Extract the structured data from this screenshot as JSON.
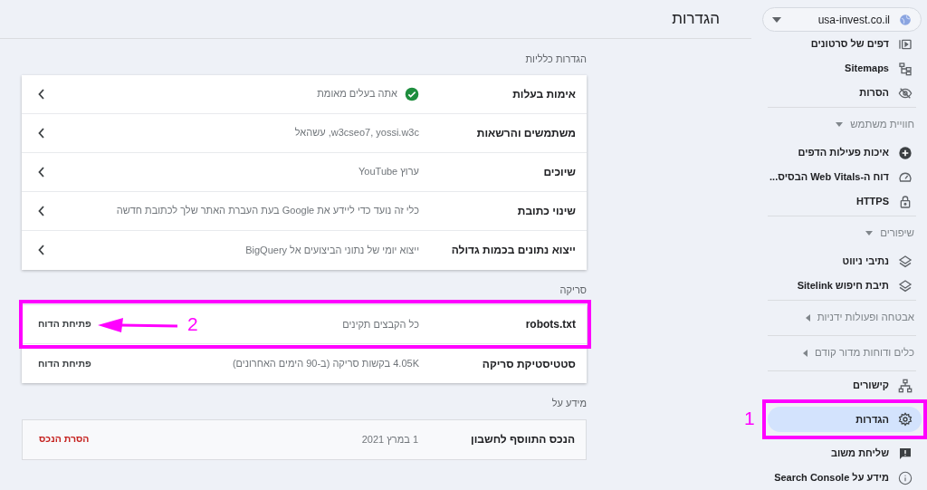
{
  "property_selector": {
    "value": "usa-invest.co.il"
  },
  "sidebar": {
    "sections": [
      {
        "items": [
          {
            "label": "דפים של סרטונים",
            "selected": false
          },
          {
            "label": "Sitemaps",
            "selected": false
          },
          {
            "label": "הסרות",
            "selected": false
          }
        ]
      },
      {
        "header": {
          "label": "חוויית משתמש",
          "expanded": true
        },
        "items": [
          {
            "label": "איכות פעילות הדפים",
            "selected": false
          },
          {
            "label": "דוח ה-Web Vitals הבסיס...",
            "selected": false
          },
          {
            "label": "HTTPS",
            "selected": false
          }
        ]
      },
      {
        "header": {
          "label": "שיפורים",
          "expanded": true
        },
        "items": [
          {
            "label": "נתיבי ניווט",
            "selected": false
          },
          {
            "label": "תיבת חיפוש Sitelink",
            "selected": false
          }
        ]
      },
      {
        "header": {
          "label": "אבטחה ופעולות ידניות",
          "expanded": false
        }
      },
      {
        "header": {
          "label": "כלים ודוחות מדור קודם",
          "expanded": false
        }
      },
      {
        "items": [
          {
            "label": "קישורים",
            "selected": false
          },
          {
            "label": "הגדרות",
            "selected": true,
            "annotation": {
              "number": "1"
            }
          },
          {
            "label": "שליחת משוב",
            "selected": false
          },
          {
            "label": "מידע על Search Console",
            "selected": false
          }
        ]
      }
    ]
  },
  "page_title": "הגדרות",
  "sections": [
    {
      "title": "הגדרות כלליות",
      "kind": "raised",
      "rows": [
        {
          "label": "אימות בעלות",
          "value": "אתה בעלים מאומת",
          "verified": true,
          "action": {
            "kind": "chevron"
          }
        },
        {
          "label": "משתמשים והרשאות",
          "value": "w3cseo7, yossi.w3c, עשהאל",
          "action": {
            "kind": "chevron"
          }
        },
        {
          "label": "שיוכים",
          "value": "ערוץ YouTube",
          "action": {
            "kind": "chevron"
          }
        },
        {
          "label": "שינוי כתובת",
          "value": "כלי זה נועד כדי ליידע את Google בעת העברת האתר שלך לכתובת חדשה",
          "action": {
            "kind": "chevron"
          }
        },
        {
          "label": "ייצוא נתונים בכמות גדולה",
          "value": "ייצוא יומי של נתוני הביצועים אל BigQuery",
          "action": {
            "kind": "chevron"
          }
        }
      ]
    },
    {
      "title": "סריקה",
      "kind": "raised",
      "rows": [
        {
          "label": "robots.txt",
          "value": "כל הקבצים תקינים",
          "action": {
            "kind": "link",
            "label": "פתיחת הדוח"
          },
          "annotation": {
            "number": "2"
          }
        },
        {
          "label": "סטטיסטיקת סריקה",
          "value": "4.05K בקשות סריקה (ב-90 הימים האחרונים)",
          "action": {
            "kind": "link",
            "label": "פתיחת הדוח"
          }
        }
      ]
    },
    {
      "title": "מידע על",
      "kind": "flat",
      "rows": [
        {
          "label": "הנכס התווסף לחשבון",
          "value": "1 במרץ 2021",
          "action": {
            "kind": "danger",
            "label": "הסרת הנכס"
          }
        }
      ]
    }
  ]
}
